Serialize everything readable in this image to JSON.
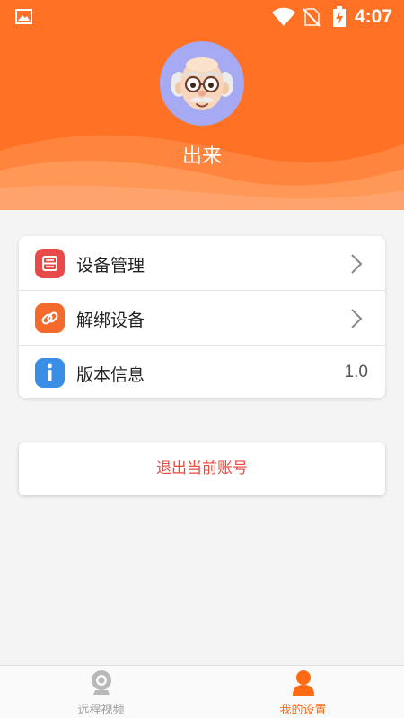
{
  "status_bar": {
    "time": "4:07"
  },
  "profile": {
    "username": "出来"
  },
  "menu": {
    "items": [
      {
        "label": "设备管理",
        "icon": "device-management-icon",
        "icon_color": "#e84a4a",
        "value": ""
      },
      {
        "label": "解绑设备",
        "icon": "unbind-link-icon",
        "icon_color": "#f46a2c",
        "value": ""
      },
      {
        "label": "版本信息",
        "icon": "info-icon",
        "icon_color": "#3a8ee6",
        "value": "1.0"
      }
    ]
  },
  "logout": {
    "label": "退出当前账号"
  },
  "tabs": [
    {
      "label": "远程视频",
      "icon": "camera-icon",
      "active": false
    },
    {
      "label": "我的设置",
      "icon": "user-icon",
      "active": true
    }
  ],
  "colors": {
    "accent": "#ff7226",
    "logout_text": "#e94a3f",
    "active_tab": "#ff6a13",
    "inactive_tab": "#9a9a9a"
  }
}
